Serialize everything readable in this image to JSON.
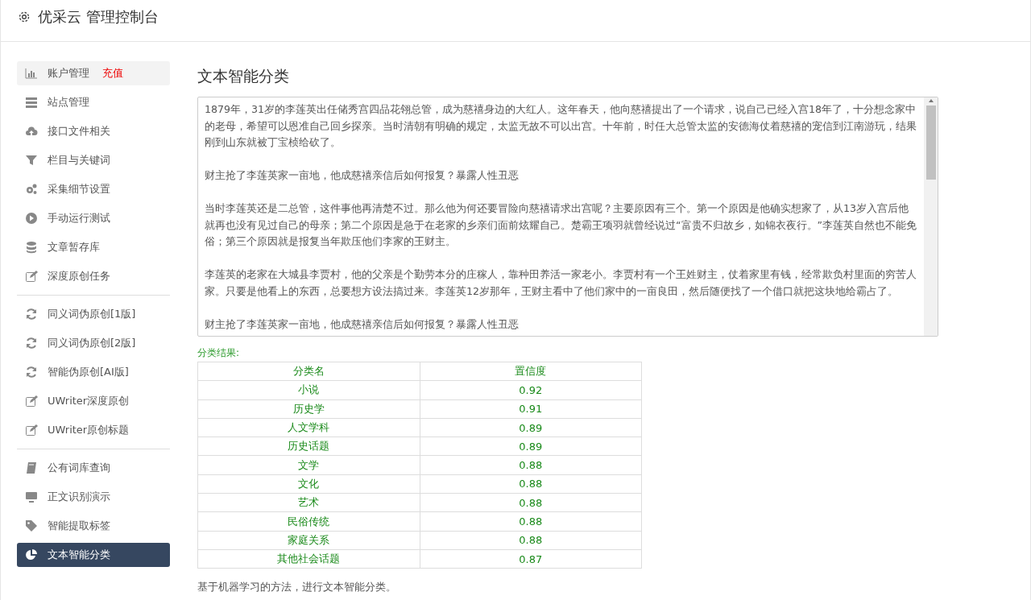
{
  "header": {
    "title": "优采云 管理控制台"
  },
  "sidebar": {
    "groups": [
      {
        "items": [
          {
            "label": "账户管理",
            "badge": "充值",
            "kind": "chart",
            "selected": false,
            "hover": true
          },
          {
            "label": "站点管理",
            "kind": "server",
            "selected": false,
            "hover": false
          },
          {
            "label": "接口文件相关",
            "kind": "cloud",
            "selected": false,
            "hover": false
          },
          {
            "label": "栏目与关键词",
            "kind": "filter",
            "selected": false,
            "hover": false
          },
          {
            "label": "采集细节设置",
            "kind": "gears",
            "selected": false,
            "hover": false
          },
          {
            "label": "手动运行测试",
            "kind": "play",
            "selected": false,
            "hover": false
          },
          {
            "label": "文章暂存库",
            "kind": "database",
            "selected": false,
            "hover": false
          },
          {
            "label": "深度原创任务",
            "kind": "edit",
            "selected": false,
            "hover": false
          }
        ]
      },
      {
        "items": [
          {
            "label": "同义词伪原创[1版]",
            "kind": "refresh",
            "selected": false,
            "hover": false
          },
          {
            "label": "同义词伪原创[2版]",
            "kind": "refresh",
            "selected": false,
            "hover": false
          },
          {
            "label": "智能伪原创[AI版]",
            "kind": "refresh",
            "selected": false,
            "hover": false
          },
          {
            "label": "UWriter深度原创",
            "kind": "edit",
            "selected": false,
            "hover": false
          },
          {
            "label": "UWriter原创标题",
            "kind": "edit",
            "selected": false,
            "hover": false
          }
        ]
      },
      {
        "items": [
          {
            "label": "公有词库查询",
            "kind": "book",
            "selected": false,
            "hover": false
          },
          {
            "label": "正文识别演示",
            "kind": "monitor",
            "selected": false,
            "hover": false
          },
          {
            "label": "智能提取标签",
            "kind": "tag",
            "selected": false,
            "hover": false
          },
          {
            "label": "文本智能分类",
            "kind": "pie",
            "selected": true,
            "hover": false
          }
        ]
      }
    ]
  },
  "main": {
    "heading": "文本智能分类",
    "text_area": {
      "paragraphs": [
        "1879年，31岁的李莲英出任储秀宫四品花翎总管，成为慈禧身边的大红人。这年春天，他向慈禧提出了一个请求，说自己已经入宫18年了，十分想念家中的老母，希望可以恩准自己回乡探亲。当时清朝有明确的规定，太监无故不可以出宫。十年前，时任大总管太监的安德海仗着慈禧的宠信到江南游玩，结果刚到山东就被丁宝桢给砍了。",
        "财主抢了李莲英家一亩地，他成慈禧亲信后如何报复？暴露人性丑恶",
        "当时李莲英还是二总管，这件事他再清楚不过。那么他为何还要冒险向慈禧请求出宫呢？主要原因有三个。第一个原因是他确实想家了，从13岁入宫后他就再也没有见过自己的母亲；第二个原因是急于在老家的乡亲们面前炫耀自己。楚霸王项羽就曾经说过“富贵不归故乡，如锦衣夜行。”李莲英自然也不能免俗；第三个原因就是报复当年欺压他们李家的王财主。",
        "李莲英的老家在大城县李贾村，他的父亲是个勤劳本分的庄稼人，靠种田养活一家老小。李贾村有一个王姓财主，仗着家里有钱，经常欺负村里面的穷苦人家。只要是他看上的东西，总要想方设法搞过来。李莲英12岁那年，王财主看中了他们家中的一亩良田，然后随便找了一个借口就把这块地给霸占了。",
        "财主抢了李莲英家一亩地，他成慈禧亲信后如何报复？暴露人性丑恶"
      ]
    },
    "result_label": "分类结果:",
    "table": {
      "columns": [
        "分类名",
        "置信度"
      ],
      "rows": [
        [
          "小说",
          "0.92"
        ],
        [
          "历史学",
          "0.91"
        ],
        [
          "人文学科",
          "0.89"
        ],
        [
          "历史话题",
          "0.89"
        ],
        [
          "文学",
          "0.88"
        ],
        [
          "文化",
          "0.88"
        ],
        [
          "艺术",
          "0.88"
        ],
        [
          "民俗传统",
          "0.88"
        ],
        [
          "家庭关系",
          "0.88"
        ],
        [
          "其他社会话题",
          "0.87"
        ]
      ]
    },
    "note": "基于机器学习的方法，进行文本智能分类。"
  }
}
